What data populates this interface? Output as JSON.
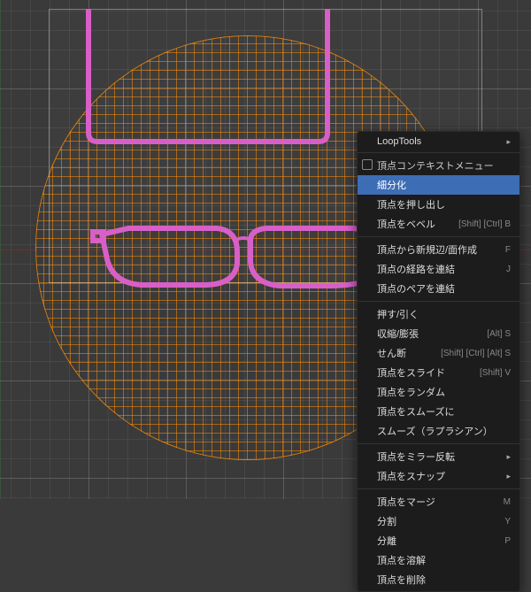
{
  "menu": {
    "loopTools": "LoopTools",
    "contextTitle": "頂点コンテキストメニュー",
    "subdivide": "細分化",
    "extrude": "頂点を押し出し",
    "bevel": "頂点をベベル",
    "bevelShortcut": "[Shift] [Ctrl] B",
    "newEdgeFace": "頂点から新規辺/面作成",
    "newEdgeFaceShortcut": "F",
    "connectPath": "頂点の経路を連結",
    "connectPathShortcut": "J",
    "connectPairs": "頂点のペアを連結",
    "pushPull": "押す/引く",
    "shrinkFatten": "収縮/膨張",
    "shrinkFattenShortcut": "[Alt] S",
    "shear": "せん断",
    "shearShortcut": "[Shift] [Ctrl] [Alt] S",
    "slide": "頂点をスライド",
    "slideShortcut": "[Shift] V",
    "randomize": "頂点をランダム",
    "smooth": "頂点をスムーズに",
    "smoothLaplacian": "スムーズ（ラプラシアン）",
    "mirror": "頂点をミラー反転",
    "snap": "頂点をスナップ",
    "merge": "頂点をマージ",
    "mergeShortcut": "M",
    "split": "分割",
    "splitShortcut": "Y",
    "separate": "分離",
    "separateShortcut": "P",
    "dissolve": "頂点を溶解",
    "delete": "頂点を削除"
  }
}
